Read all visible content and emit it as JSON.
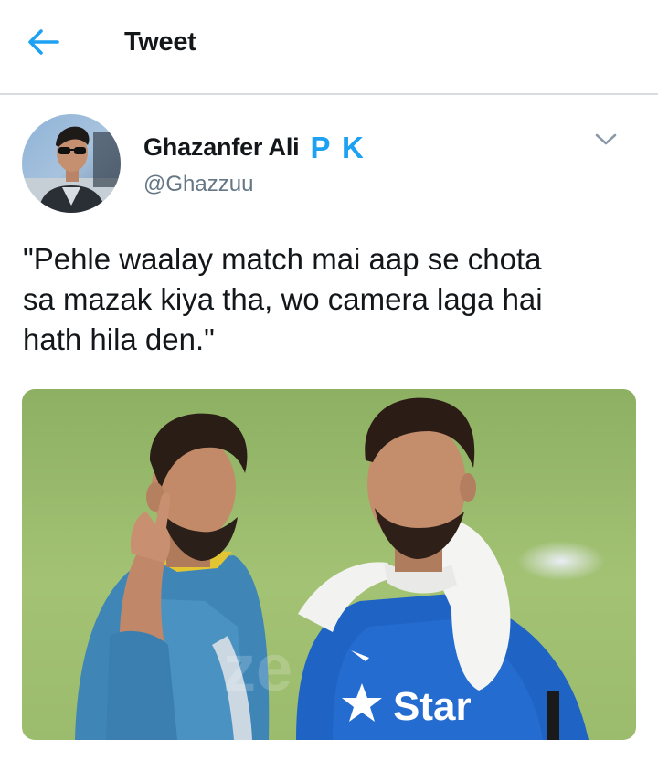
{
  "header": {
    "title": "Tweet",
    "back_icon": "arrow-left-icon",
    "accent_color": "#1da1f2"
  },
  "tweet": {
    "display_name": "Ghazanfer Ali",
    "name_suffix": "P K",
    "handle": "@Ghazzuu",
    "text": "\"Pehle waalay match mai aap se chota\nsa mazak kiya tha, wo camera laga hai\nhath hila den.\"",
    "menu_icon": "chevron-down-icon",
    "media": {
      "jersey_text": "Star",
      "watermark": "ze"
    }
  },
  "colors": {
    "text_primary": "#14171a",
    "text_secondary": "#657786",
    "divider": "#d8dde1",
    "pitch_green": "#9cb86a"
  }
}
